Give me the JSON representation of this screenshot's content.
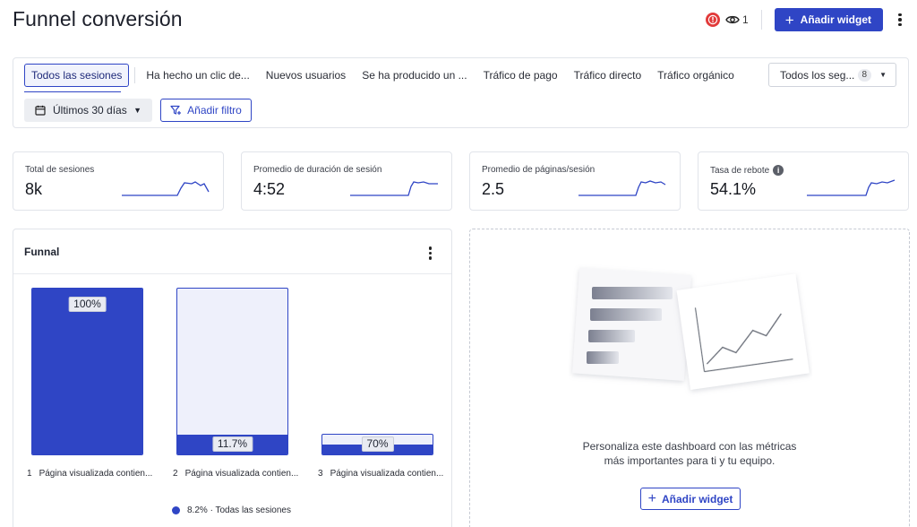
{
  "header": {
    "title": "Funnel conversión",
    "viewer_count": "1",
    "add_widget_label": "Añadir widget"
  },
  "filters": {
    "segments": [
      "Todos las sesiones",
      "Ha hecho un clic de...",
      "Nuevos usuarios",
      "Se ha producido un ...",
      "Tráfico de pago",
      "Tráfico directo",
      "Tráfico orgánico"
    ],
    "all_segments_label": "Todos los seg...",
    "all_segments_count": "8",
    "date_range": "Últimos 30 días",
    "add_filter_label": "Añadir filtro"
  },
  "kpis": [
    {
      "label": "Total de sesiones",
      "value": "8k"
    },
    {
      "label": "Promedio de duración de sesión",
      "value": "4:52"
    },
    {
      "label": "Promedio de páginas/sesión",
      "value": "2.5"
    },
    {
      "label": "Tasa de rebote",
      "value": "54.1%"
    }
  ],
  "funnel": {
    "title": "Funnal",
    "steps": [
      {
        "num": "1",
        "label": "Página visualizada contien...",
        "value_label": "100%",
        "fill": 1.0
      },
      {
        "num": "2",
        "label": "Página visualizada contien...",
        "value_label": "11.7%",
        "fill": 0.117
      },
      {
        "num": "3",
        "label": "Página visualizada contien...",
        "value_label": "70%",
        "fill": 0.7
      }
    ],
    "legend": "8.2% · Todas las sesiones"
  },
  "empty_widget": {
    "line1": "Personaliza este dashboard con las métricas",
    "line2": "más importantes para ti y tu equipo.",
    "button_label": "Añadir widget"
  },
  "colors": {
    "accent": "#2f45c5",
    "alert": "#e23b3b"
  }
}
